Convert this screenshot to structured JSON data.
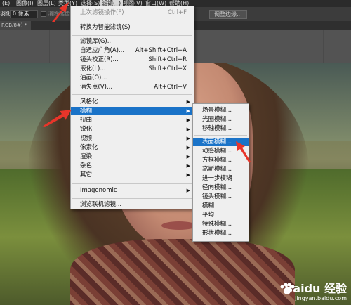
{
  "menubar": {
    "items": [
      {
        "label": "(E)",
        "active": false
      },
      {
        "label": "图像(I)",
        "active": false
      },
      {
        "label": "图层(L)",
        "active": false
      },
      {
        "label": "类型(Y)",
        "active": false
      },
      {
        "label": "选择(S)",
        "active": false
      },
      {
        "label": "滤镜(T)",
        "active": true
      },
      {
        "label": "视图(V)",
        "active": false
      },
      {
        "label": "窗口(W)",
        "active": false
      },
      {
        "label": "帮助(H)",
        "active": false
      }
    ]
  },
  "options": {
    "feather_label": "羽化:",
    "feather_value": "0 像素",
    "antialias_label": "消除锯齿",
    "refine_edge_label": "调整边缘..."
  },
  "doc_tab": {
    "label": "RGB/8#) *"
  },
  "filter_menu": {
    "last_filter": {
      "label": "上次滤镜操作(F)",
      "shortcut": "Ctrl+F"
    },
    "convert_smart": {
      "label": "转换为智能滤镜(S)"
    },
    "filter_gallery": {
      "label": "滤镜库(G)..."
    },
    "adaptive_wide": {
      "label": "自适应广角(A)...",
      "shortcut": "Alt+Shift+Ctrl+A"
    },
    "lens_correction": {
      "label": "镜头校正(R)...",
      "shortcut": "Shift+Ctrl+R"
    },
    "liquify": {
      "label": "液化(L)...",
      "shortcut": "Shift+Ctrl+X"
    },
    "oil_paint": {
      "label": "油画(O)..."
    },
    "vanishing_point": {
      "label": "消失点(V)...",
      "shortcut": "Alt+Ctrl+V"
    },
    "stylize": {
      "label": "风格化"
    },
    "blur": {
      "label": "模糊"
    },
    "distort": {
      "label": "扭曲"
    },
    "sharpen": {
      "label": "锐化"
    },
    "video": {
      "label": "视频"
    },
    "pixelate": {
      "label": "像素化"
    },
    "render": {
      "label": "渲染"
    },
    "noise": {
      "label": "杂色"
    },
    "other": {
      "label": "其它"
    },
    "imagenomic": {
      "label": "Imagenomic"
    },
    "browse_online": {
      "label": "浏览联机滤镜..."
    }
  },
  "blur_submenu": {
    "items": [
      {
        "label": "场景模糊..."
      },
      {
        "label": "光圈模糊..."
      },
      {
        "label": "移轴模糊..."
      },
      {
        "label": "表面模糊..."
      },
      {
        "label": "动感模糊..."
      },
      {
        "label": "方框模糊..."
      },
      {
        "label": "高斯模糊..."
      },
      {
        "label": "进一步模糊"
      },
      {
        "label": "径向模糊..."
      },
      {
        "label": "镜头模糊..."
      },
      {
        "label": "模糊"
      },
      {
        "label": "平均"
      },
      {
        "label": "特殊模糊..."
      },
      {
        "label": "形状模糊..."
      }
    ]
  },
  "watermark": {
    "name": "Baidu 经验",
    "url": "jingyan.baidu.com"
  },
  "colors": {
    "highlight": "#1a73c8",
    "arrow": "#e8352a"
  }
}
